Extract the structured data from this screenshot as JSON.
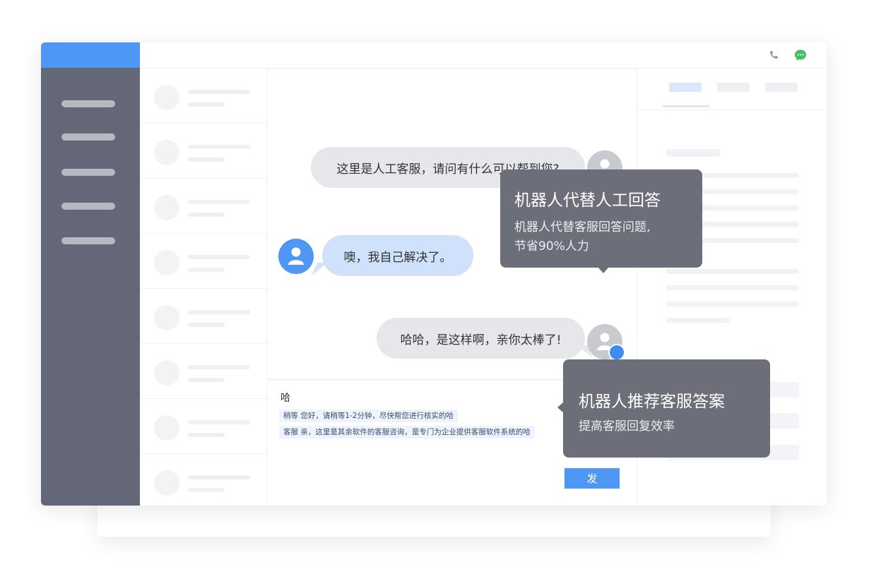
{
  "topbar": {
    "phone_icon": "phone-icon",
    "chat_icon": "chat-bubble-icon"
  },
  "messages": [
    {
      "from": "agent",
      "text": "这里是人工客服，请问有什么可以帮到您?"
    },
    {
      "from": "customer",
      "text": "噢，我自己解决了。"
    },
    {
      "from": "robot",
      "text": "哈哈，是这样啊，亲你太棒了!"
    }
  ],
  "tooltips": {
    "robot_replace": {
      "title": "机器人代替人工回答",
      "line1": "机器人代替客服回答问题,",
      "line2": "节省90%人力"
    },
    "robot_recommend": {
      "title": "机器人推荐客服答案",
      "line1": "提高客服回复效率"
    }
  },
  "input": {
    "typed_text": "哈",
    "suggestions": [
      "稍等 您好，请稍等1-2分钟，尽快帮您进行核实的哈",
      "客服 亲，这里是其余软件的客服咨询，是专门为企业提供客服软件系统的哈"
    ],
    "send_label": "发"
  },
  "colors": {
    "brand_blue": "#4f97f5",
    "sidebar": "#646778",
    "tooltip": "#6c6f79",
    "customer_bubble": "#cfe1fb",
    "agent_bubble": "#e6e7eb"
  }
}
